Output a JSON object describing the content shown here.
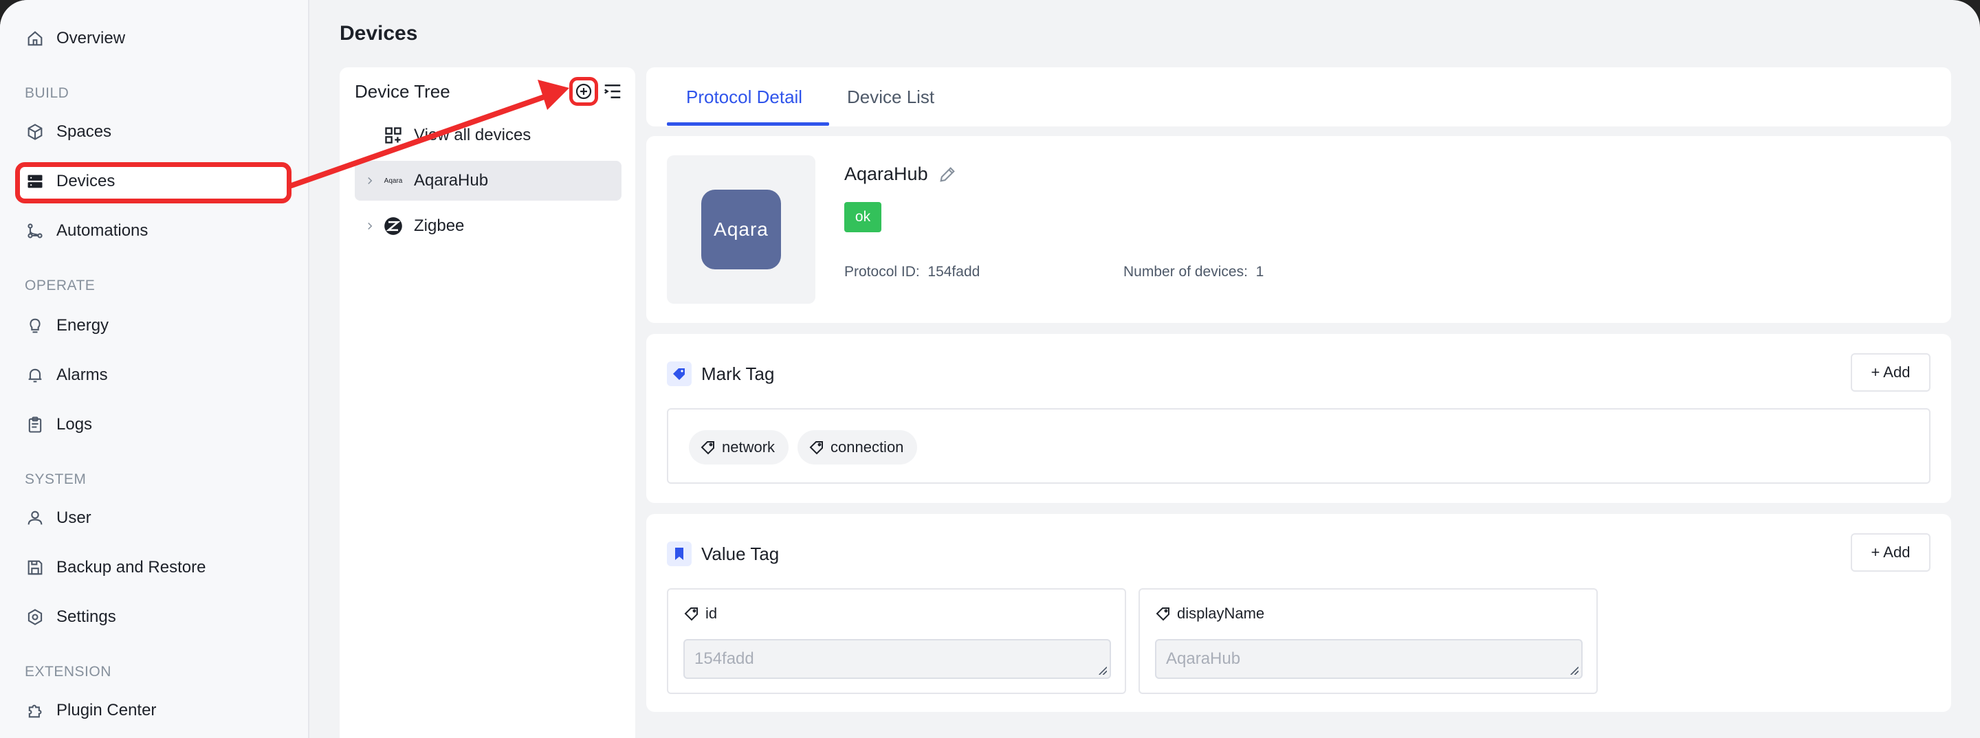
{
  "page": {
    "title": "Devices"
  },
  "sidebar": {
    "items": [
      {
        "label": "Overview",
        "icon": "home-icon"
      },
      {
        "label": "Spaces",
        "icon": "cube-icon"
      },
      {
        "label": "Devices",
        "icon": "server-icon"
      },
      {
        "label": "Automations",
        "icon": "flow-icon"
      },
      {
        "label": "Energy",
        "icon": "bulb-icon"
      },
      {
        "label": "Alarms",
        "icon": "bell-icon"
      },
      {
        "label": "Logs",
        "icon": "clipboard-icon"
      },
      {
        "label": "User",
        "icon": "user-icon"
      },
      {
        "label": "Backup and Restore",
        "icon": "save-icon"
      },
      {
        "label": "Settings",
        "icon": "gear-icon"
      },
      {
        "label": "Plugin Center",
        "icon": "puzzle-icon"
      }
    ],
    "sections": [
      "BUILD",
      "OPERATE",
      "SYSTEM",
      "EXTENSION"
    ]
  },
  "tree": {
    "title": "Device Tree",
    "view_all": "View all devices",
    "nodes": [
      {
        "label": "AqaraHub",
        "selected": true
      },
      {
        "label": "Zigbee",
        "selected": false
      }
    ]
  },
  "tabs": [
    {
      "label": "Protocol Detail",
      "active": true
    },
    {
      "label": "Device List",
      "active": false
    }
  ],
  "detail": {
    "logo_text": "Aqara",
    "name": "AqaraHub",
    "status": "ok",
    "protocol_id_label": "Protocol ID:",
    "protocol_id": "154fadd",
    "device_count_label": "Number of devices:",
    "device_count": "1"
  },
  "mark_tag": {
    "title": "Mark Tag",
    "add_label": "+ Add",
    "tags": [
      "network",
      "connection"
    ]
  },
  "value_tag": {
    "title": "Value Tag",
    "add_label": "+ Add",
    "fields": [
      {
        "label": "id",
        "placeholder": "154fadd"
      },
      {
        "label": "displayName",
        "placeholder": "AqaraHub"
      }
    ]
  },
  "colors": {
    "accent": "#2f54eb",
    "highlight": "#ee2b2b",
    "status_ok": "#33c15a",
    "logo_bg": "#5b6b9c"
  }
}
